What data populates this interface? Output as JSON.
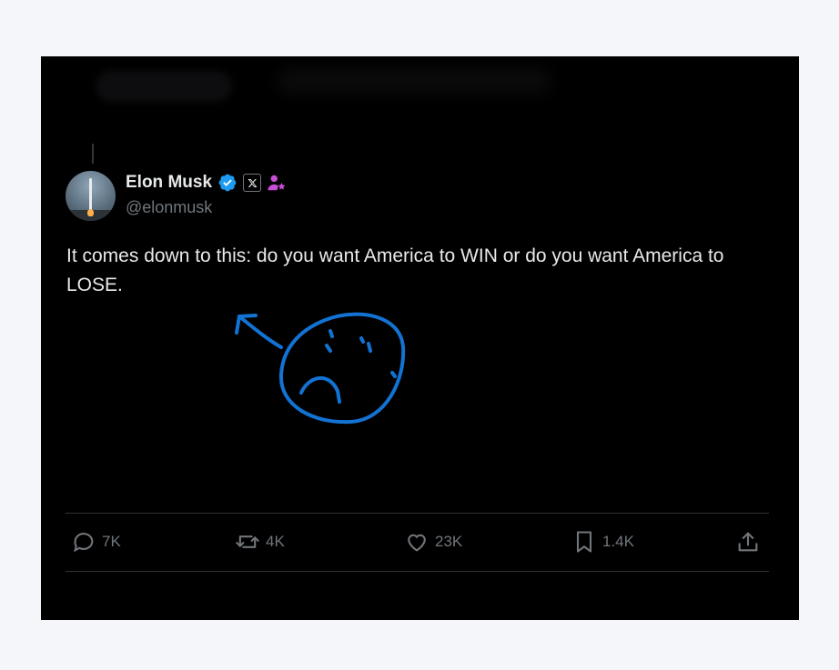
{
  "author": {
    "name": "Elon Musk",
    "handle": "@elonmusk"
  },
  "tweet": {
    "text": "It comes down to this: do you want America to WIN or do you want America to LOSE."
  },
  "actions": {
    "replies": "7K",
    "reposts": "4K",
    "likes": "23K",
    "bookmarks": "1.4K"
  },
  "colors": {
    "background": "#000000",
    "text": "#e7e9ea",
    "muted": "#71767b",
    "verified": "#1d9bf0",
    "doodle": "#1273d4",
    "badge": "#c94ed6"
  },
  "icons": [
    "verified-badge-icon",
    "x-affiliate-icon",
    "user-badge-icon",
    "reply-icon",
    "repost-icon",
    "like-icon",
    "bookmark-icon",
    "share-icon"
  ]
}
